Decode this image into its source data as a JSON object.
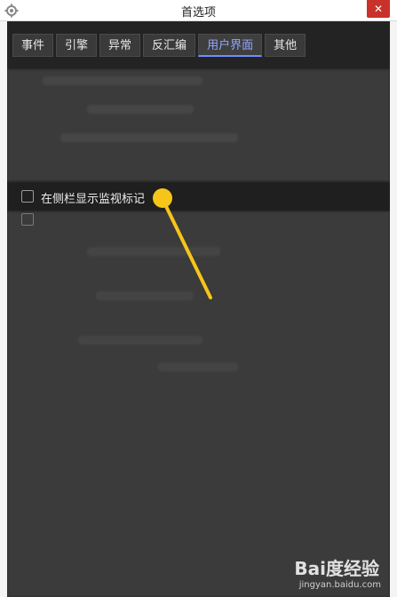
{
  "window": {
    "title": "首选项",
    "close_glyph": "✕"
  },
  "tabs": [
    {
      "label": "事件",
      "active": false
    },
    {
      "label": "引擎",
      "active": false
    },
    {
      "label": "异常",
      "active": false
    },
    {
      "label": "反汇编",
      "active": false
    },
    {
      "label": "用户界面",
      "active": true
    },
    {
      "label": "其他",
      "active": false
    }
  ],
  "option": {
    "label": "在侧栏显示监视标记",
    "checked": false
  },
  "annotation": {
    "color": "#f5c518",
    "icon": "pointer-callout"
  },
  "watermark": {
    "logo": "Bai度经验",
    "url": "jingyan.baidu.com"
  },
  "colors": {
    "accent_tab": "#8fa7ff",
    "close_button": "#c9312b"
  }
}
